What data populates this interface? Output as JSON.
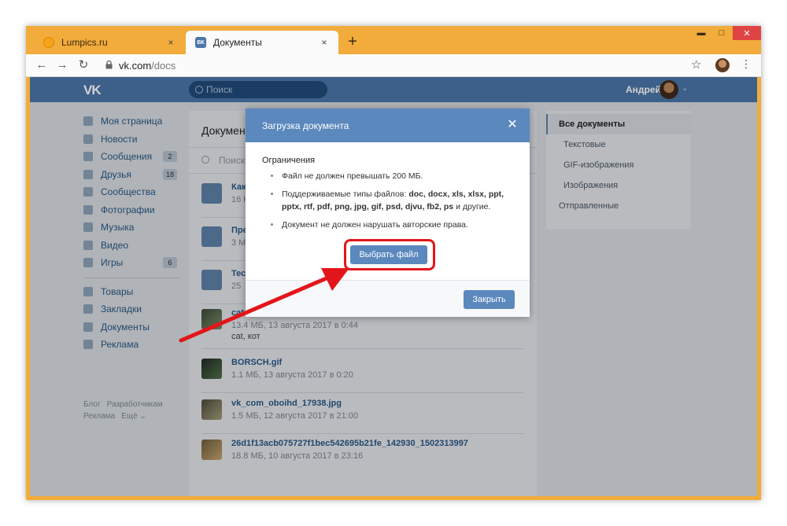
{
  "browser": {
    "tabs": [
      {
        "title": "Lumpics.ru",
        "close": "×"
      },
      {
        "title": "Документы",
        "close": "×",
        "favicon": "ВК"
      }
    ],
    "new_tab": "+",
    "window_controls": {
      "minimize": "▬",
      "maximize": "□",
      "close": "✕"
    },
    "nav": {
      "back": "←",
      "forward": "→",
      "reload": "↻"
    },
    "url": {
      "domain": "vk.com",
      "path": "/docs"
    },
    "bookmark_star": "☆",
    "menu_dots": "⋮"
  },
  "vk": {
    "logo": "VK",
    "search_placeholder": "Поиск",
    "user_name": "Андрей",
    "left_menu": [
      {
        "label": "Моя страница",
        "icon": "home-icon"
      },
      {
        "label": "Новости",
        "icon": "news-icon"
      },
      {
        "label": "Сообщения",
        "icon": "messages-icon",
        "badge": "2"
      },
      {
        "label": "Друзья",
        "icon": "friends-icon",
        "badge": "18"
      },
      {
        "label": "Сообщества",
        "icon": "communities-icon"
      },
      {
        "label": "Фотографии",
        "icon": "photos-icon"
      },
      {
        "label": "Музыка",
        "icon": "music-icon"
      },
      {
        "label": "Видео",
        "icon": "video-icon"
      },
      {
        "label": "Игры",
        "icon": "games-icon",
        "badge": "6"
      }
    ],
    "left_menu_2": [
      {
        "label": "Товары",
        "icon": "goods-icon"
      },
      {
        "label": "Закладки",
        "icon": "bookmarks-icon"
      },
      {
        "label": "Документы",
        "icon": "documents-icon"
      },
      {
        "label": "Реклама",
        "icon": "ads-icon"
      }
    ],
    "footer_links": [
      "Блог",
      "Разработчикам",
      "Реклама",
      "Ещё ⌄"
    ],
    "main": {
      "title": "Документ",
      "search_placeholder": "Поиск,",
      "docs": [
        {
          "name": "Как",
          "meta": "16 К",
          "tags": ""
        },
        {
          "name": "Пре",
          "meta": "3 М",
          "tags": ""
        },
        {
          "name": "Тест",
          "meta": "25",
          "tags": ""
        },
        {
          "name": "cat",
          "meta": "13.4 МБ, 13 августа 2017 в 0:44",
          "tags": "cat, кот"
        },
        {
          "name": "BORSCH.gif",
          "meta": "1.1 МБ, 13 августа 2017 в 0:20",
          "tags": ""
        },
        {
          "name": "vk_com_oboihd_17938.jpg",
          "meta": "1.5 МБ, 12 августа 2017 в 21:00",
          "tags": ""
        },
        {
          "name": "26d1f13acb075727f1bec542695b21fe_142930_1502313997",
          "meta": "18.8 МБ, 10 августа 2017 в 23:16",
          "tags": ""
        }
      ]
    },
    "right_menu": [
      "Все документы",
      "Текстовые",
      "GIF-изображения",
      "Изображения",
      "Отправленные"
    ]
  },
  "modal": {
    "title": "Загрузка документа",
    "close_icon": "✕",
    "restrictions_heading": "Ограничения",
    "rule1": "Файл не должен превышать 200 МБ.",
    "rule2_prefix": "Поддерживаемые типы файлов: ",
    "rule2_types": "doc, docx, xls, xlsx, ppt, pptx, rtf, pdf, png, jpg, gif, psd, djvu, fb2, ps",
    "rule2_suffix": " и другие.",
    "rule3": "Документ не должен нарушать авторские права.",
    "choose_file": "Выбрать файл",
    "close_button": "Закрыть"
  },
  "colors": {
    "window_frame": "#f2ac3b",
    "vk_header": "#4a76a8",
    "modal_header": "#5b88bd",
    "highlight_ring": "#e2161a"
  }
}
